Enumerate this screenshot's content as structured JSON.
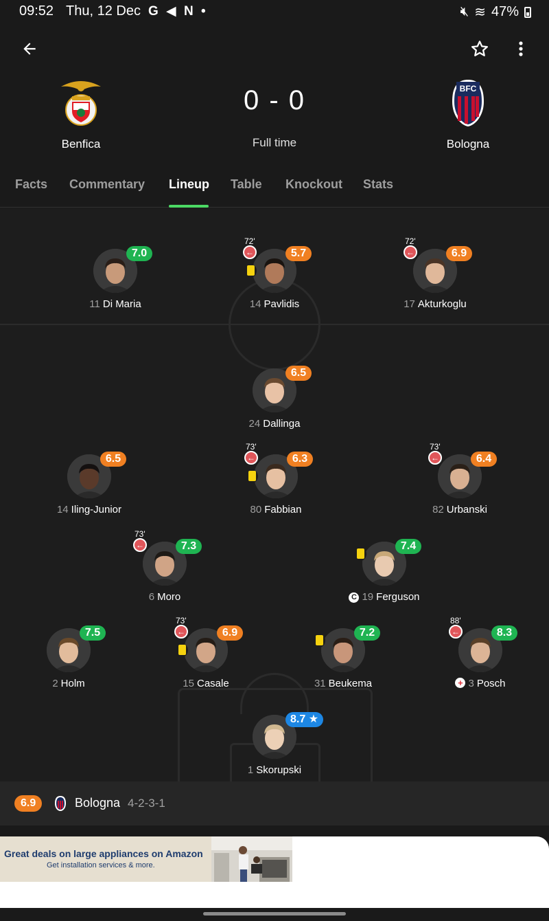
{
  "status_bar": {
    "time": "09:52",
    "date": "Thu, 12 Dec",
    "notifications": "G ◀ N •",
    "battery": "47%"
  },
  "match": {
    "home_team": "Benfica",
    "away_team": "Bologna",
    "score": "0 - 0",
    "status": "Full time"
  },
  "tabs": [
    "Facts",
    "Commentary",
    "Lineup",
    "Table",
    "Knockout",
    "Stats"
  ],
  "active_tab": "Lineup",
  "lineup": {
    "players": [
      {
        "number": "11",
        "name": "Di Maria",
        "rating": "7.0",
        "rating_color": "green"
      },
      {
        "number": "14",
        "name": "Pavlidis",
        "rating": "5.7",
        "rating_color": "orange",
        "sub_minute": "72'",
        "yellow_card": true
      },
      {
        "number": "17",
        "name": "Akturkoglu",
        "rating": "6.9",
        "rating_color": "orange",
        "sub_minute": "72'"
      },
      {
        "number": "24",
        "name": "Dallinga",
        "rating": "6.5",
        "rating_color": "orange"
      },
      {
        "number": "14",
        "name": "Iling-Junior",
        "rating": "6.5",
        "rating_color": "orange"
      },
      {
        "number": "80",
        "name": "Fabbian",
        "rating": "6.3",
        "rating_color": "orange",
        "sub_minute": "73'",
        "yellow_card": true
      },
      {
        "number": "82",
        "name": "Urbanski",
        "rating": "6.4",
        "rating_color": "orange",
        "sub_minute": "73'"
      },
      {
        "number": "6",
        "name": "Moro",
        "rating": "7.3",
        "rating_color": "green",
        "sub_minute": "73'"
      },
      {
        "number": "19",
        "name": "Ferguson",
        "rating": "7.4",
        "rating_color": "green",
        "yellow_card": true,
        "captain": true
      },
      {
        "number": "2",
        "name": "Holm",
        "rating": "7.5",
        "rating_color": "green"
      },
      {
        "number": "15",
        "name": "Casale",
        "rating": "6.9",
        "rating_color": "orange",
        "sub_minute": "73'",
        "yellow_card": true
      },
      {
        "number": "31",
        "name": "Beukema",
        "rating": "7.2",
        "rating_color": "green",
        "yellow_card": true
      },
      {
        "number": "3",
        "name": "Posch",
        "rating": "8.3",
        "rating_color": "green",
        "sub_minute": "88'",
        "injured": true
      },
      {
        "number": "1",
        "name": "Skorupski",
        "rating": "8.7 ★",
        "rating_color": "blue"
      }
    ],
    "captain_badge": "C",
    "injury_badge": "+"
  },
  "team_bar": {
    "rating": "6.9",
    "team_name": "Bologna",
    "formation": "4-2-3-1"
  },
  "ad": {
    "title": "Great deals on large appliances on Amazon",
    "subtitle": "Get installation services & more."
  },
  "colors": {
    "rating_green": "#1fb452",
    "rating_orange": "#f08022",
    "rating_blue": "#1d87e4",
    "tab_indicator": "#4cd964",
    "sub_icon": "#e0565a",
    "yellow_card": "#f5d20f"
  }
}
